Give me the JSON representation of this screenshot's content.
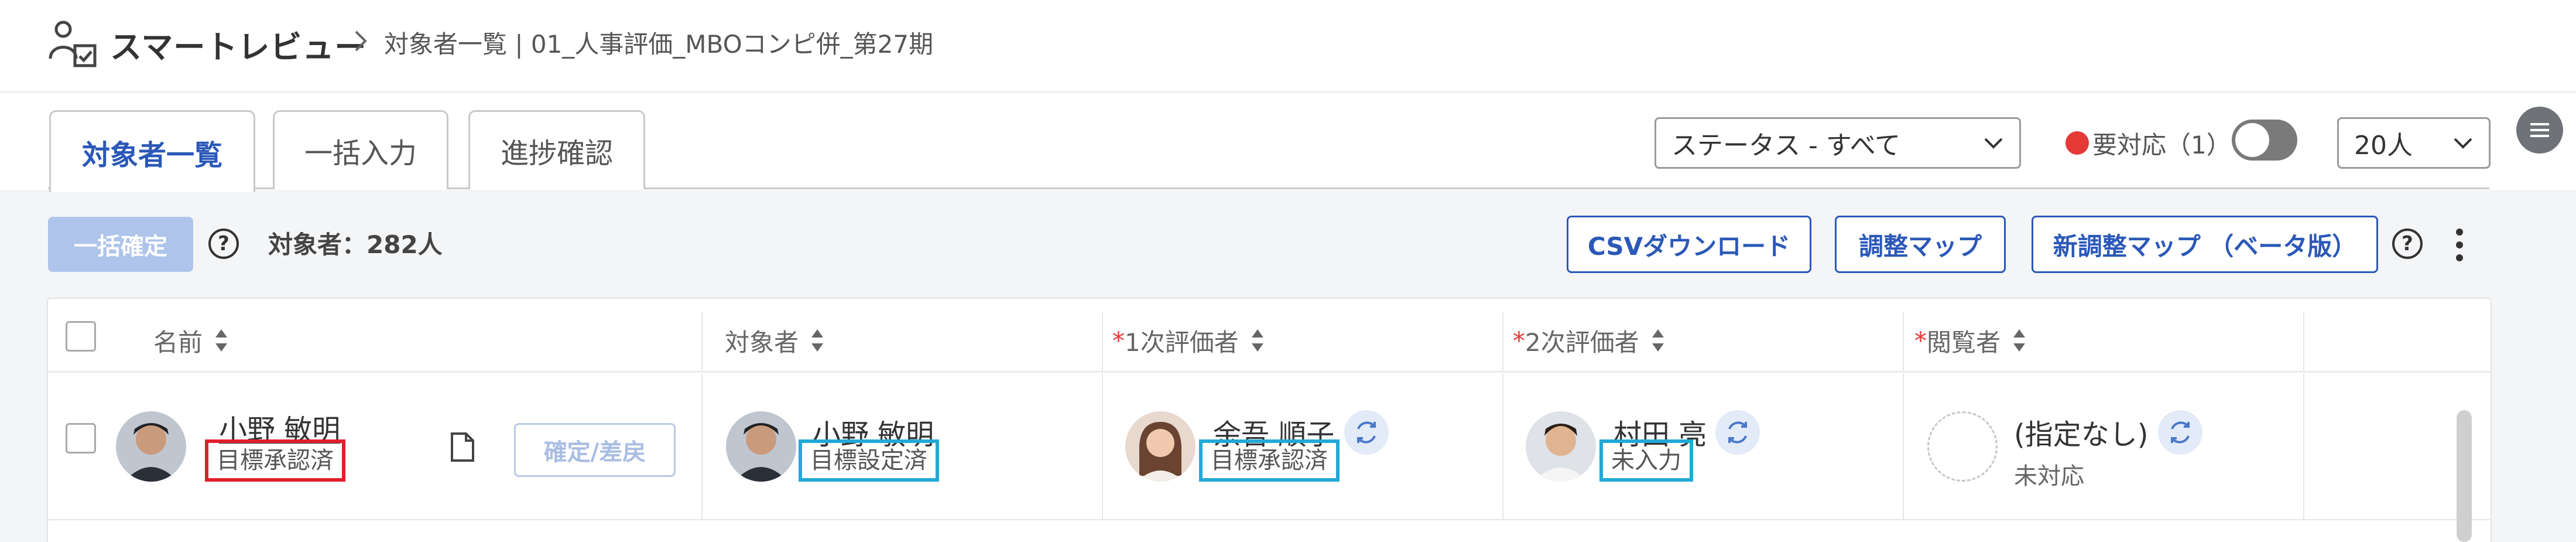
{
  "header": {
    "app_title": "スマートレビュー",
    "breadcrumb": "対象者一覧 | 01_人事評価_MBOコンピ併_第27期"
  },
  "tabs": [
    {
      "label": "対象者一覧",
      "active": true
    },
    {
      "label": "一括入力",
      "active": false
    },
    {
      "label": "進捗確認",
      "active": false
    }
  ],
  "filters": {
    "status_select": "ステータス - すべて",
    "needs_action_label": "要対応（1）",
    "needs_action_toggle_on": false,
    "page_size_select": "20人"
  },
  "toolbar": {
    "confirm_all": "一括確定",
    "target_count": "対象者：282人",
    "csv_download": "CSVダウンロード",
    "adjust_map": "調整マップ",
    "new_adjust_map": "新調整マップ （ベータ版）",
    "help_glyph": "?"
  },
  "table": {
    "headers": {
      "name": "名前",
      "target": "対象者",
      "first_evaluator_mark": "*",
      "first_evaluator": "1次評価者",
      "second_evaluator_mark": "*",
      "second_evaluator": "2次評価者",
      "viewer_mark": "*",
      "viewer": "閲覧者"
    },
    "rows": [
      {
        "name": "小野 敏明",
        "name_status": "目標承認済",
        "action_button": "確定/差戻",
        "target_name": "小野 敏明",
        "target_status": "目標設定済",
        "first_evaluator_name": "余吾 順子",
        "first_evaluator_status": "目標承認済",
        "second_evaluator_name": "村田 亮",
        "second_evaluator_status": "未入力",
        "viewer_name": "(指定なし)",
        "viewer_status": "未対応"
      }
    ]
  },
  "colors": {
    "accent": "#2b58b8",
    "highlight_red": "#e0202c",
    "highlight_cyan": "#21a9d8",
    "alert_dot": "#e53935"
  }
}
